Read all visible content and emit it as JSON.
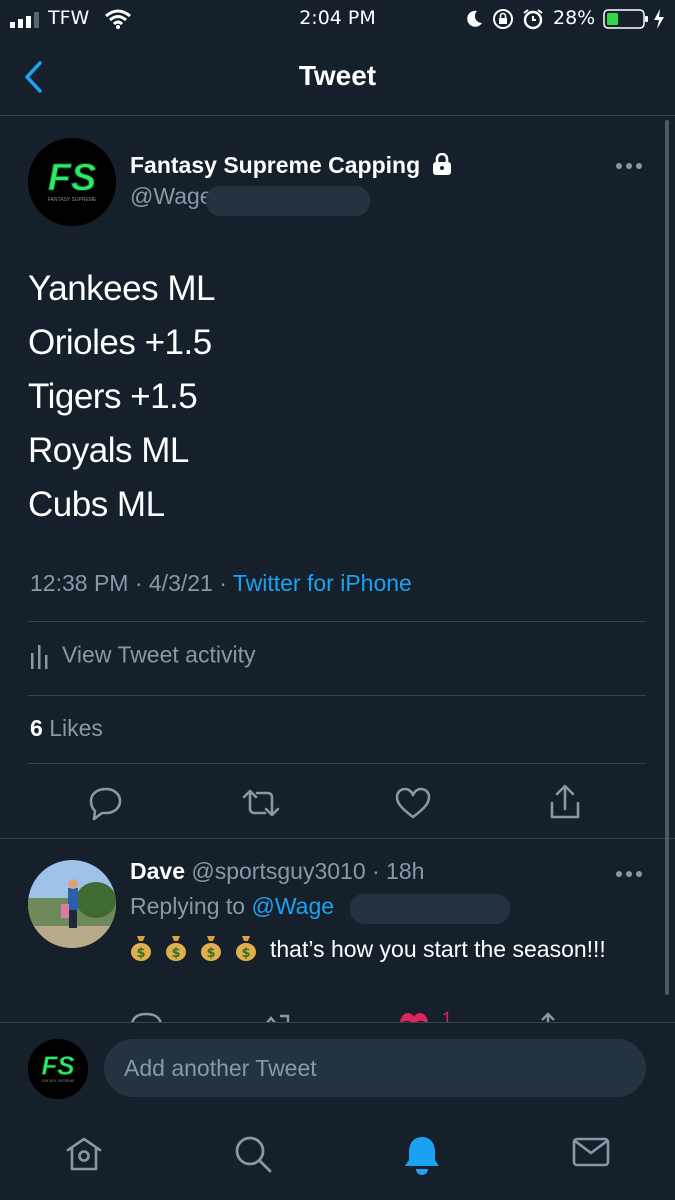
{
  "status_bar": {
    "carrier": "TFW",
    "time": "2:04 PM",
    "battery": "28%"
  },
  "header": {
    "title": "Tweet"
  },
  "tweet": {
    "author_name": "Fantasy Supreme Capping",
    "author_handle": "@Wage",
    "avatar_text": "FS",
    "avatar_subtext": "FANTASY SUPREME",
    "lines": [
      "Yankees ML",
      "Orioles +1.5",
      "Tigers +1.5",
      "Royals ML",
      "Cubs ML"
    ],
    "timestamp": "12:38 PM · 4/3/21 · ",
    "source": "Twitter for iPhone",
    "activity_label": "View Tweet activity",
    "likes_count": "6",
    "likes_label": "Likes"
  },
  "reply": {
    "name": "Dave",
    "handle_time": "@sportsguy3010 · 18h",
    "replying_label": "Replying to ",
    "replying_handle": "@Wage",
    "text_suffix": "that’s how you start the season!!!",
    "partial_like_count": "1"
  },
  "compose": {
    "placeholder": "Add another Tweet"
  },
  "colors": {
    "background": "#15202b",
    "accent": "#1da1f2",
    "muted": "#8899a6",
    "divider": "#38444d",
    "brand_green": "#2ee86a",
    "like_pink": "#e0245e"
  },
  "icons": [
    "signal-icon",
    "wifi-icon",
    "moon-icon",
    "orientation-lock-icon",
    "alarm-icon",
    "battery-icon",
    "charging-icon",
    "back-arrow-icon",
    "lock-icon",
    "more-icon",
    "bar-chart-icon",
    "reply-icon",
    "retweet-icon",
    "like-icon",
    "share-icon",
    "money-bag-icon",
    "home-icon",
    "search-icon",
    "notifications-icon",
    "messages-icon"
  ]
}
